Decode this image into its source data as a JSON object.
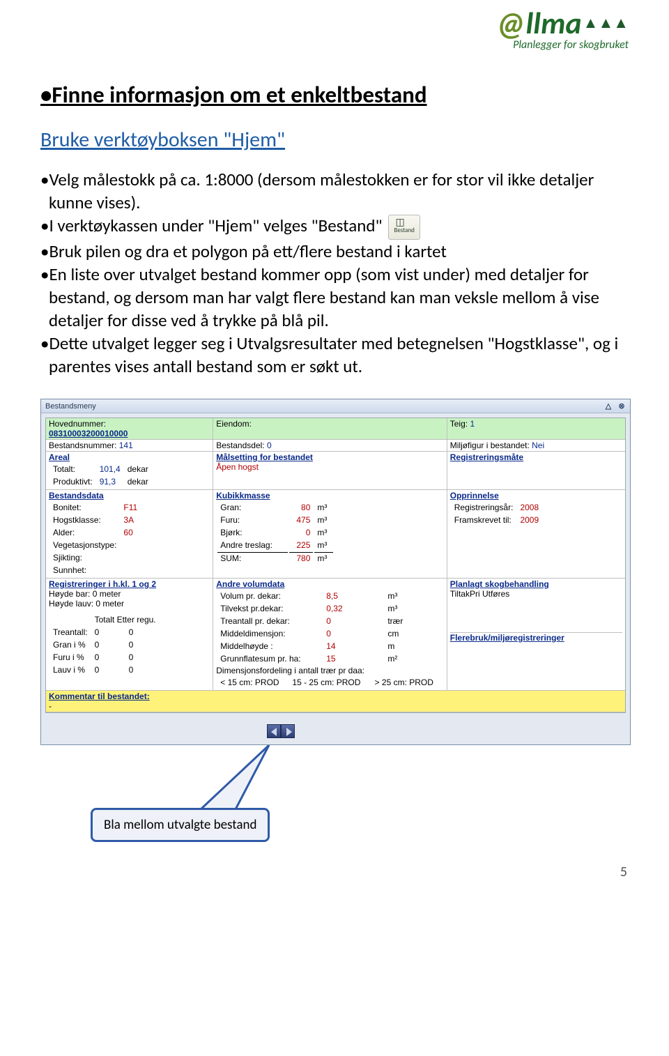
{
  "logo": {
    "text": "llma",
    "sub": "Planlegger for skogbruket"
  },
  "title": "•Finne informasjon om et enkeltbestand",
  "subtitle": "Bruke verktøyboksen \"Hjem\"",
  "bullets": {
    "b1": "•Velg målestokk på ca. 1:8000 (dersom målestokken er for stor vil ikke detaljer kunne vises).",
    "b2": "•I verktøykassen under \"Hjem\" velges \"Bestand\"",
    "b3": "•Bruk pilen og dra et polygon på ett/flere bestand i kartet",
    "b4": "•En liste over utvalget bestand kommer opp (som vist under) med detaljer for bestand, og dersom man har valgt flere bestand kan man veksle mellom å vise detaljer for disse ved å trykke på blå pil.",
    "b5": "•Dette utvalget legger seg i Utvalgsresultater med betegnelsen \"Hogstklasse\", og i parentes vises antall bestand som er søkt ut."
  },
  "iconBestand": "Bestand",
  "win": {
    "title": "Bestandsmeny",
    "row1": {
      "hoved_lbl": "Hovednummer:",
      "hoved_val": "08310003200010000",
      "eiendom_lbl": "Eiendom:",
      "teig_lbl": "Teig:",
      "teig_val": "1"
    },
    "row2": {
      "bestnr_lbl": "Bestandsnummer:",
      "bestnr_val": "141",
      "bestdel_lbl": "Bestandsdel:",
      "bestdel_val": "0",
      "miljo_lbl": "Miljøfigur i bestandet:",
      "miljo_val": "Nei"
    },
    "areal": {
      "head": "Areal",
      "tot_lbl": "Totalt:",
      "tot_val": "101,4",
      "tot_unit": "dekar",
      "prod_lbl": "Produktivt:",
      "prod_val": "91,3",
      "prod_unit": "dekar"
    },
    "mal": {
      "head": "Målsetting for bestandet",
      "val": "Åpen hogst"
    },
    "regm": {
      "head": "Registreringsmåte"
    },
    "bdata": {
      "head": "Bestandsdata",
      "bonitet_lbl": "Bonitet:",
      "bonitet_val": "F11",
      "hogst_lbl": "Hogstklasse:",
      "hogst_val": "3A",
      "alder_lbl": "Alder:",
      "alder_val": "60",
      "veg_lbl": "Vegetasjonstype:",
      "sjikt_lbl": "Sjikting:",
      "sunn_lbl": "Sunnhet:"
    },
    "kubikk": {
      "head": "Kubikkmasse",
      "gran_lbl": "Gran:",
      "gran_val": "80",
      "unit": "m³",
      "furu_lbl": "Furu:",
      "furu_val": "475",
      "bjork_lbl": "Bjørk:",
      "bjork_val": "0",
      "andre_lbl": "Andre treslag:",
      "andre_val": "225",
      "sum_lbl": "SUM:",
      "sum_val": "780"
    },
    "oppr": {
      "head": "Opprinnelse",
      "reg_lbl": "Registreringsår:",
      "reg_val": "2008",
      "fram_lbl": "Framskrevet til:",
      "fram_val": "2009"
    },
    "regs": {
      "head": "Registreringer i h.kl. 1 og 2",
      "hbar": "Høyde bar: 0 meter",
      "hlauv": "Høyde lauv: 0 meter",
      "cols": "Totalt Etter regu.",
      "tre_lbl": "Treantall:",
      "tre_a": "0",
      "tre_b": "0",
      "gran_lbl": "Gran i %",
      "gran_a": "0",
      "gran_b": "0",
      "furu_lbl": "Furu i %",
      "furu_a": "0",
      "furu_b": "0",
      "lauv_lbl": "Lauv i %",
      "lauv_a": "0",
      "lauv_b": "0"
    },
    "vol": {
      "head": "Andre volumdata",
      "r1_lbl": "Volum pr. dekar:",
      "r1_val": "8,5",
      "r1_u": "m³",
      "r2_lbl": "Tilvekst pr.dekar:",
      "r2_val": "0,32",
      "r2_u": "m³",
      "r3_lbl": "Treantall pr. dekar:",
      "r3_val": "0",
      "r3_u": "trær",
      "r4_lbl": "Middeldimensjon:",
      "r4_val": "0",
      "r4_u": "cm",
      "r5_lbl": "Middelhøyde :",
      "r5_val": "14",
      "r5_u": "m",
      "r6_lbl": "Grunnflatesum pr. ha:",
      "r6_val": "15",
      "r6_u": "m²",
      "dim_lbl": "Dimensjonsfordeling i antall trær pr daa:",
      "dim_a": "< 15 cm: PROD",
      "dim_b": "15 - 25 cm: PROD",
      "dim_c": "> 25 cm: PROD"
    },
    "plan": {
      "head": "Planlagt skogbehandling",
      "val": "TiltakPri Utføres"
    },
    "flere": {
      "head": "Flerebruk/miljøregistreringer"
    },
    "kom": {
      "head": "Kommentar til bestandet:"
    }
  },
  "callout": "Bla mellom utvalgte bestand",
  "pagenum": "5"
}
